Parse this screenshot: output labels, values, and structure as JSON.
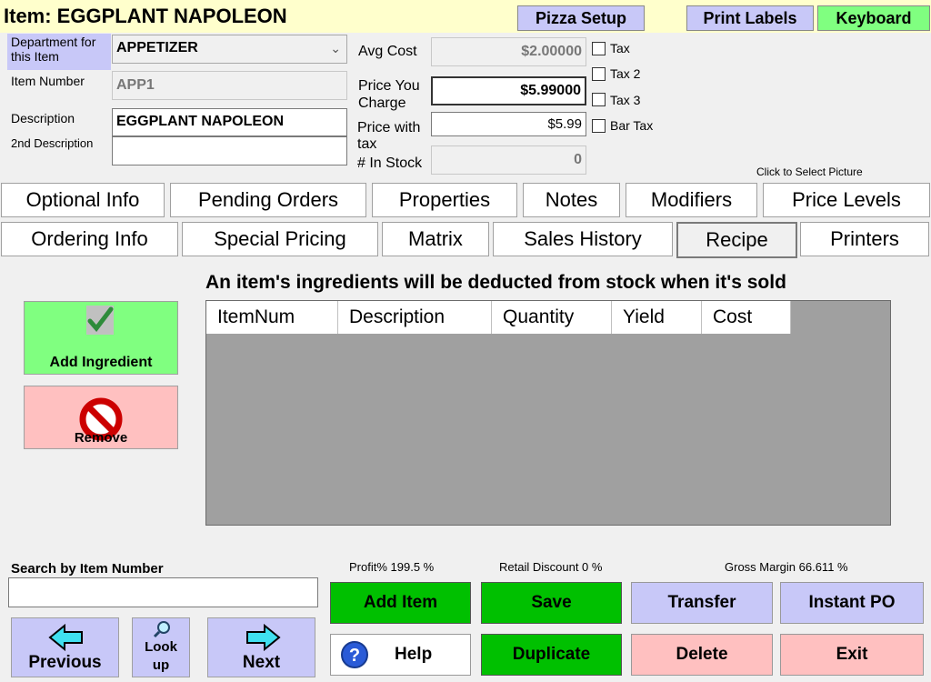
{
  "header": {
    "title": "Item: EGGPLANT NAPOLEON",
    "pizza_setup": "Pizza Setup",
    "print_labels": "Print Labels",
    "keyboard": "Keyboard"
  },
  "form": {
    "department_label": "Department for this Item",
    "department_value": "APPETIZER",
    "item_number_label": "Item Number",
    "item_number_value": "APP1",
    "description_label": "Description",
    "description_value": "EGGPLANT NAPOLEON",
    "description2_label": "2nd Description",
    "description2_value": "",
    "avg_cost_label": "Avg Cost",
    "avg_cost_value": "$2.00000",
    "price_label": "Price You Charge",
    "price_value": "$5.99000",
    "price_tax_label": "Price with tax",
    "price_tax_value": "$5.99",
    "in_stock_label": "# In Stock",
    "in_stock_value": "0",
    "tax_label": "Tax",
    "tax2_label": "Tax 2",
    "tax3_label": "Tax 3",
    "bar_tax_label": "Bar Tax",
    "picture_hint": "Click to Select Picture"
  },
  "tabs_row1": [
    "Optional Info",
    "Pending Orders",
    "Properties",
    "Notes",
    "Modifiers",
    "Price Levels"
  ],
  "tabs_row2": [
    "Ordering Info",
    "Special Pricing",
    "Matrix",
    "Sales History",
    "Recipe",
    "Printers"
  ],
  "recipe": {
    "heading": "An item's ingredients will be deducted from stock when it's sold",
    "columns": [
      "ItemNum",
      "Description",
      "Quantity",
      "Yield",
      "Cost"
    ],
    "add_ingredient": "Add Ingredient",
    "remove": "Remove"
  },
  "footer": {
    "search_label": "Search by Item Number",
    "search_value": "",
    "profit": "Profit%   199.5 %",
    "retail_discount": "Retail Discount   0 %",
    "gross_margin": "Gross Margin   66.611 %",
    "previous": "Previous",
    "lookup": "Look up",
    "next": "Next",
    "add_item": "Add Item",
    "save": "Save",
    "transfer": "Transfer",
    "instant_po": "Instant PO",
    "help": "Help",
    "duplicate": "Duplicate",
    "delete": "Delete",
    "exit": "Exit"
  },
  "colors": {
    "title_bg": "#ffffcc",
    "green": "#00c000",
    "lavender": "#c8c8f8",
    "pink": "#ffc0c0",
    "light_green": "#80ff80"
  }
}
